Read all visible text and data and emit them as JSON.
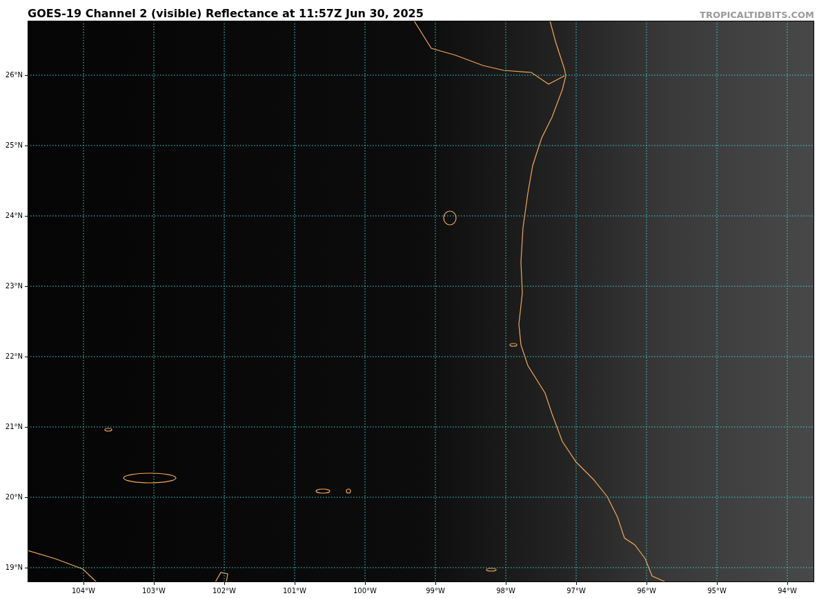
{
  "title": "GOES-19 Channel 2 (visible) Reflectance at 11:57Z Jun 30, 2025",
  "credit": "TROPICALTIDBITS.COM",
  "map": {
    "lat_labels": [
      "26°N",
      "25°N",
      "24°N",
      "23°N",
      "22°N",
      "21°N",
      "20°N",
      "19°N"
    ],
    "lon_labels": [
      "104°W",
      "103°W",
      "102°W",
      "101°W",
      "100°W",
      "99°W",
      "98°W",
      "97°W",
      "96°W",
      "95°W",
      "94°W"
    ]
  }
}
